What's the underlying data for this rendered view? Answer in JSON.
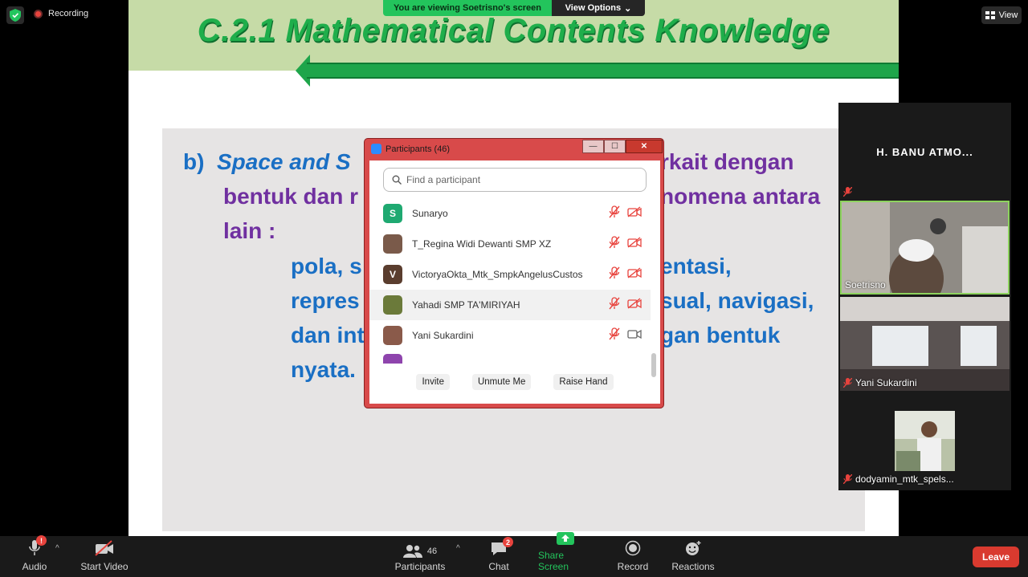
{
  "top": {
    "recording_label": "Recording",
    "viewing_label": "You are viewing Soetrisno's screen",
    "view_options_label": "View Options",
    "view_label": "View"
  },
  "slide": {
    "title": "C.2.1 Mathematical Contents Knowledge",
    "line1_bullet": "b)",
    "line1_italic": "Space and S",
    "line1_right": "rkait dengan",
    "line2_left": "bentuk dan r",
    "line2_right": "nomena antara",
    "line3": "lain :",
    "line4_left": "pola,  s",
    "line4_right": "entasi,",
    "line5_left": "repres",
    "line5_right": "sual,  navigasi,",
    "line6_left": "dan int",
    "line6_right": "gan bentuk",
    "line7": "nyata."
  },
  "participants_dialog": {
    "title": "Participants (46)",
    "search_placeholder": "Find a participant",
    "minimize": "—",
    "maximize": "☐",
    "close": "✕",
    "participants": [
      {
        "name": "Sunaryo",
        "initial": "S",
        "avatar_color": "#1fa971",
        "video": "off"
      },
      {
        "name": "T_Regina Widi Dewanti SMP XZ",
        "initial": "",
        "avatar_color": "#7a5a4a",
        "video": "off"
      },
      {
        "name": "VictoryaOkta_Mtk_SmpkAngelusCustos",
        "initial": "V",
        "avatar_color": "#5a3d2e",
        "video": "off"
      },
      {
        "name": "Yahadi SMP TA'MIRIYAH",
        "initial": "",
        "avatar_color": "#6b7a3a",
        "video": "off"
      },
      {
        "name": "Yani Sukardini",
        "initial": "",
        "avatar_color": "#8a5a4a",
        "video": "on"
      }
    ],
    "invite_label": "Invite",
    "unmute_label": "Unmute Me",
    "raise_hand_label": "Raise Hand"
  },
  "videos": [
    {
      "name": "H. BANU ATMO..."
    },
    {
      "name": "Soetrisno"
    },
    {
      "name": "Yani Sukardini"
    },
    {
      "name": "dodyamin_mtk_spels..."
    }
  ],
  "toolbar": {
    "audio_label": "Audio",
    "audio_badge": "!",
    "start_video_label": "Start Video",
    "participants_label": "Participants",
    "participants_count": "46",
    "chat_label": "Chat",
    "chat_badge": "2",
    "share_label": "Share Screen",
    "record_label": "Record",
    "reactions_label": "Reactions",
    "leave_label": "Leave"
  },
  "colors": {
    "share_green": "#23c45c",
    "leave_red": "#d93a2f",
    "slide_title_green": "#1fae4b",
    "slide_blue": "#1a6fc4",
    "slide_purple": "#7030a0"
  }
}
